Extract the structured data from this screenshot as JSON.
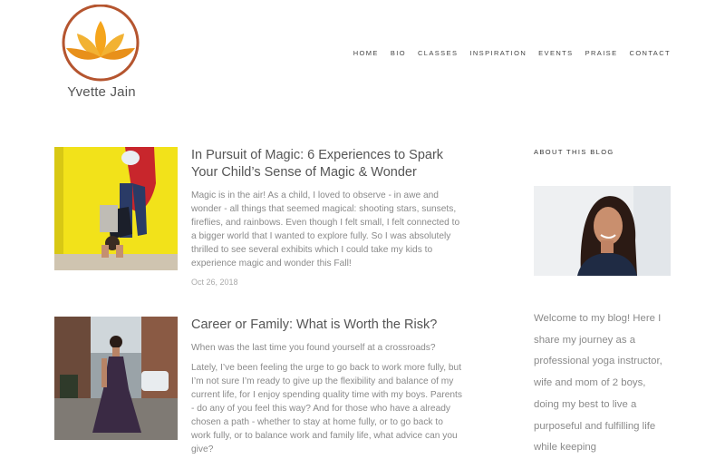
{
  "brand": {
    "name": "Yvette Jain",
    "accent": "#f2a31f",
    "ring": "#b5552f"
  },
  "nav": [
    "HOME",
    "BIO",
    "CLASSES",
    "INSPIRATION",
    "EVENTS",
    "PRAISE",
    "CONTACT"
  ],
  "posts": [
    {
      "title": "In Pursuit of Magic: 6 Experiences to Spark Your Child’s Sense of Magic & Wonder",
      "excerpt": [
        "Magic is in the air! As a child, I loved to observe - in awe and wonder - all things that seemed magical: shooting stars, sunsets, fireflies, and rainbows. Even though I felt small, I felt connected to a bigger world that I wanted to explore fully. So I was absolutely thrilled to see several exhibits which I could take my kids to experience magic and wonder this Fall!"
      ],
      "date": "Oct 26, 2018"
    },
    {
      "title": "Career or Family: What is Worth the Risk?",
      "excerpt": [
        "When was the last time you found yourself at a crossroads?",
        "Lately, I’ve been feeling the urge to go back to work more fully, but I’m not sure I’m ready to give up the flexibility and balance of my current life, for I enjoy spending quality time with my boys. Parents - do any of you feel this way? And for those who have a already chosen a path - whether to stay at home fully, or to go back to work fully, or to balance work and family life, what advice can you give?"
      ]
    }
  ],
  "sidebar": {
    "heading": "ABOUT THIS BLOG",
    "text": "Welcome to my blog! Here I share my journey as a professional yoga instructor, wife and mom of 2 boys, doing my best to live a purposeful and fulfilling life while keeping"
  }
}
